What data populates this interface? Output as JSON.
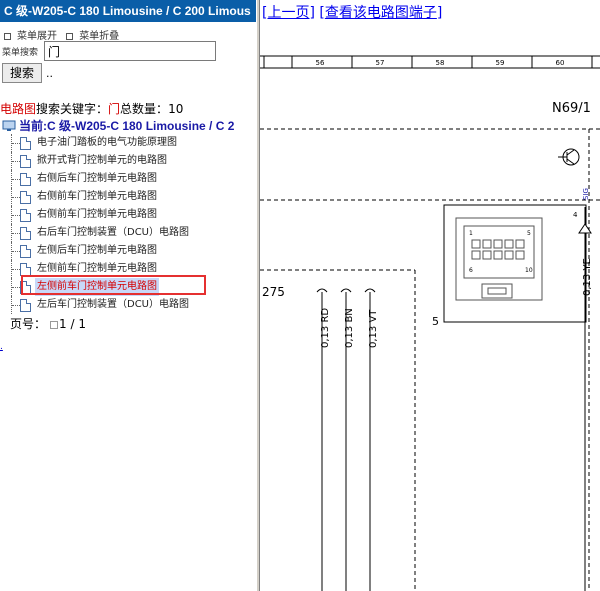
{
  "left_panel": {
    "window_title": "C 级-W205-C 180 Limousine / C 200 Limous",
    "menu": {
      "expand_label": "菜单展开",
      "collapse_label": "菜单折叠"
    },
    "search": {
      "label": "菜单搜索",
      "value": "门",
      "button_label": "搜索",
      "dots": ".."
    },
    "result": {
      "prefix": "电路图",
      "keyword_label": "搜索关键字：",
      "keyword": "门",
      "count_label": "总数量：",
      "count": "10"
    },
    "current": "当前:C 级-W205-C 180 Limousine / C 2",
    "items": [
      {
        "label": "电子油门踏板的电气功能原理图"
      },
      {
        "label": "掀开式背门控制单元的电路图"
      },
      {
        "label": "右侧后车门控制单元电路图"
      },
      {
        "label": "右侧前车门控制单元电路图"
      },
      {
        "label": "右侧前车门控制单元电路图"
      },
      {
        "label": "右后车门控制装置（DCU）电路图"
      },
      {
        "label": "左侧后车门控制单元电路图"
      },
      {
        "label": "左侧前车门控制单元电路图"
      },
      {
        "label": "左侧前车门控制单元电路图"
      },
      {
        "label": "左后车门控制装置（DCU）电路图"
      }
    ],
    "selected_index": 8,
    "pager": {
      "label": "页号：",
      "current": "1",
      "separator": "/",
      "total": "1"
    },
    "tiny_link": "."
  },
  "right_panel": {
    "nav": {
      "prev_label": "上一页",
      "terminals_label": "查看该电路图端子"
    },
    "diagram": {
      "ruler_labels": [
        "56",
        "57",
        "58",
        "59",
        "60"
      ],
      "component_id": "N69/1",
      "sig_label": "SIG",
      "pin_top": "4",
      "connector_pin_1": "1",
      "connector_pin_5": "5",
      "connector_pin_6": "6",
      "connector_pin_10": "10",
      "box_number": "5",
      "left_ref": "275",
      "wire_labels": [
        "0,13 RD",
        "0,13 BN",
        "0,13 VT"
      ],
      "right_wire_label": "0,13 YE"
    }
  }
}
